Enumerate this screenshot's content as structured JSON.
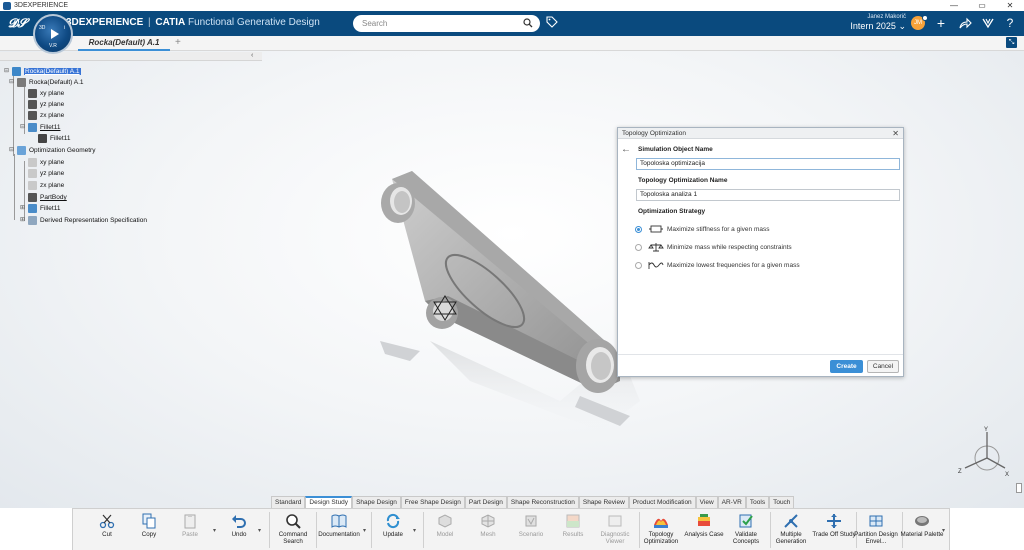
{
  "os_window": {
    "title": "3DEXPERIENCE",
    "controls": [
      "—",
      "▭",
      "✕"
    ]
  },
  "topbar": {
    "brand_main": "3DEXPERIENCE",
    "brand_sep": "|",
    "brand_product": "CATIA",
    "app_name": "Functional Generative Design",
    "search_placeholder": "Search",
    "user_name": "Janez Makorič",
    "collab_space": "Intern 2025",
    "avatar_initials": "JM",
    "compass_version": "V.R"
  },
  "tabs": {
    "document": "Rocka(Default) A.1",
    "add": "+"
  },
  "tree": {
    "root": "Rocka(Default) A.1",
    "part": "Rocka(Default) A.1",
    "xy": "xy plane",
    "yz": "yz plane",
    "zx": "zx plane",
    "fillet_group": "Fillet11",
    "fillet_child": "Fillet11",
    "opt_geom": "Optimization Geometry",
    "og_xy": "xy plane",
    "og_yz": "yz plane",
    "og_zx": "zx plane",
    "partbody": "PartBody",
    "og_fillet": "Fillet11",
    "derived": "Derived Representation Specification"
  },
  "dialog": {
    "title": "Topology Optimization",
    "sim_label": "Simulation Object Name",
    "sim_value": "Topoloska optimizacija",
    "topo_label": "Topology Optimization Name",
    "topo_value": "Topoloska analiza 1",
    "strategy_label": "Optimization Strategy",
    "options": [
      "Maximize stiffness for a given mass",
      "Minimize mass while respecting constraints",
      "Maximize lowest frequencies for a given mass"
    ],
    "selected_option": 0,
    "create": "Create",
    "cancel": "Cancel"
  },
  "workbench_tabs": [
    "Standard",
    "Design Study",
    "Shape Design",
    "Free Shape Design",
    "Part Design",
    "Shape Reconstruction",
    "Shape Review",
    "Product Modification",
    "View",
    "AR-VR",
    "Tools",
    "Touch"
  ],
  "active_workbench_tab": "Design Study",
  "actions": {
    "cut": "Cut",
    "copy": "Copy",
    "paste": "Paste",
    "undo": "Undo",
    "command_search": "Command Search",
    "documentation": "Documentation",
    "update": "Update",
    "model": "Model",
    "mesh": "Mesh",
    "scenario": "Scenario",
    "results": "Results",
    "diagnostic_viewer": "Diagnostic Viewer",
    "topology_optimization": "Topology Optimization",
    "analysis_case": "Analysis Case",
    "validate_concepts": "Validate Concepts",
    "multiple_generation": "Multiple Generation",
    "trade_off_study": "Trade Off Study",
    "partition_design": "Partition Design Envel...",
    "material_palette": "Material Palette"
  },
  "axis": {
    "x": "X",
    "y": "Y",
    "z": "Z"
  },
  "colors": {
    "topbar": "#0a4a7e",
    "accent": "#3b8fd6",
    "tree_selected": "#3874d6"
  }
}
